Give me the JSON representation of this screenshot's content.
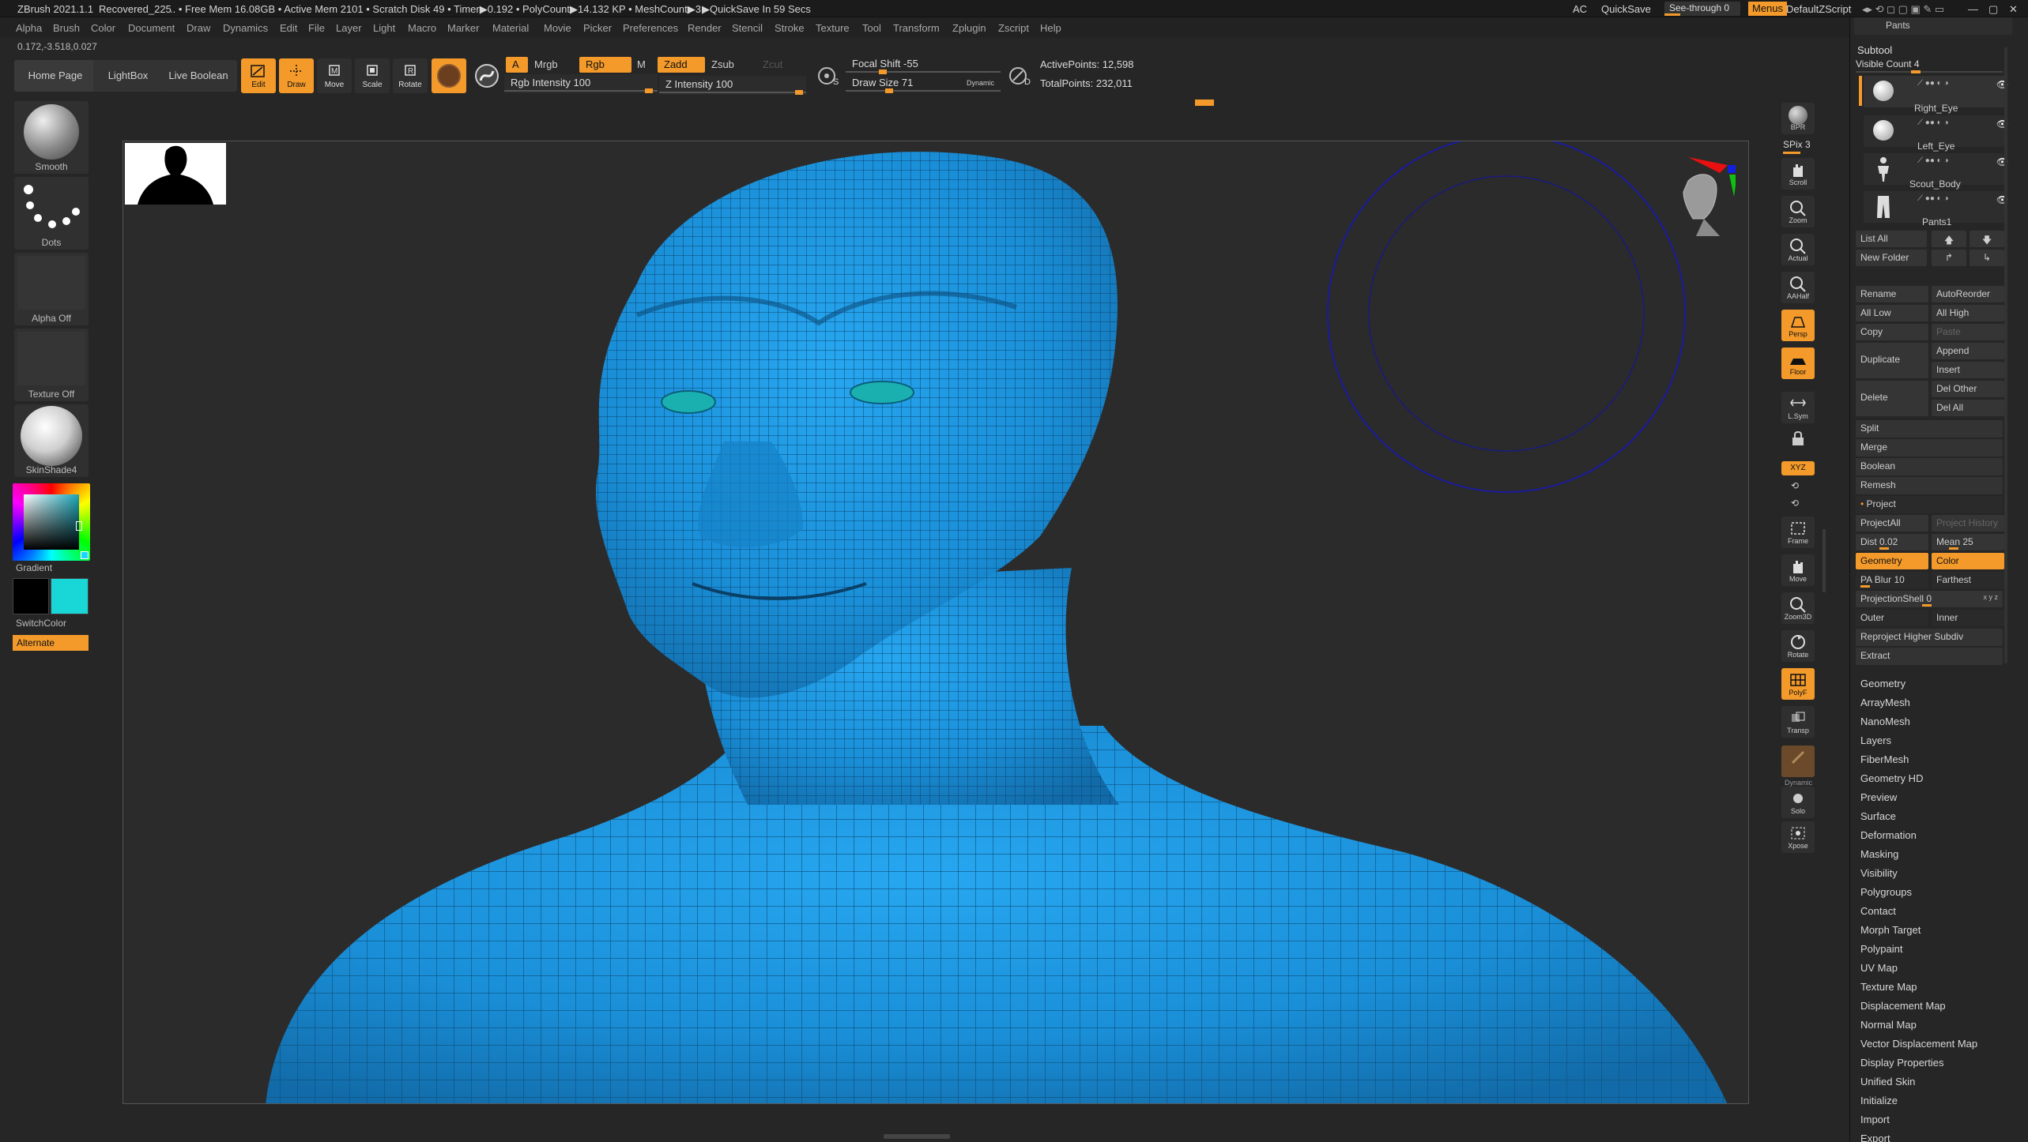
{
  "title_bar": {
    "app": "ZBrush 2021.1.1",
    "file": "Recovered_225",
    "stats": ".. • Free Mem 16.08GB • Active Mem 2101 • Scratch Disk 49 • Timer▶0.192 • PolyCount▶14.132 KP • MeshCount▶3",
    "quicksave_timer": "▶QuickSave In 59 Secs",
    "ac": "AC",
    "quicksave": "QuickSave",
    "see_through": "See-through   0",
    "menus": "Menus",
    "default_zscript": "DefaultZScript"
  },
  "menu": [
    "Alpha",
    "Brush",
    "Color",
    "Document",
    "Draw",
    "Dynamics",
    "Edit",
    "File",
    "Layer",
    "Light",
    "Macro",
    "Marker",
    "Material",
    "Movie",
    "Picker",
    "Preferences",
    "Render",
    "Stencil",
    "Stroke",
    "Texture",
    "Tool",
    "Transform",
    "Zplugin",
    "Zscript",
    "Help"
  ],
  "coords": "0.172,-3.518,0.027",
  "toolbar": {
    "home_page": "Home Page",
    "lightbox": "LightBox",
    "live_boolean": "Live Boolean",
    "edit": "Edit",
    "draw": "Draw",
    "move": "Move",
    "scale": "Scale",
    "rotate": "Rotate",
    "a": "A",
    "mrgb": "Mrgb",
    "rgb": "Rgb",
    "m": "M",
    "zadd": "Zadd",
    "zsub": "Zsub",
    "zcut": "Zcut",
    "rgb_intensity": "Rgb Intensity 100",
    "z_intensity": "Z Intensity 100",
    "focal_shift": "Focal Shift -55",
    "draw_size": "Draw Size 71",
    "dynamic": "Dynamic",
    "active_points": "ActivePoints: 12,598",
    "total_points": "TotalPoints: 232,011",
    "s_label": "S",
    "d_label": "D"
  },
  "left_shelf": {
    "smooth": "Smooth",
    "dots": "Dots",
    "alpha_off": "Alpha Off",
    "texture_off": "Texture Off",
    "material": "SkinShade4",
    "gradient": "Gradient",
    "switch_color": "SwitchColor",
    "alternate": "Alternate",
    "main_color": "#000000",
    "secondary_color": "#19d7d7"
  },
  "right_shelf": {
    "bpr": "BPR",
    "spix": "SPix 3",
    "scroll": "Scroll",
    "zoom": "Zoom",
    "actual": "Actual",
    "aahalf": "AAHalf",
    "persp": "Persp",
    "floor": "Floor",
    "lsym": "L.Sym",
    "xyz": "XYZ",
    "frame": "Frame",
    "move": "Move",
    "zoom3d": "Zoom3D",
    "rotate": "Rotate",
    "polyf": "PolyF",
    "transp": "Transp",
    "dynamic": "Dynamic",
    "solo": "Solo",
    "xpose": "Xpose"
  },
  "right_panel": {
    "pants_header": "Pants",
    "subtool_title": "Subtool",
    "visible_count": "Visible Count 4",
    "subtools": [
      "Right_Eye",
      "Left_Eye",
      "Scout_Body",
      "Pants1"
    ],
    "list_all": "List All",
    "new_folder": "New Folder",
    "rename": "Rename",
    "autoreorder": "AutoReorder",
    "all_low": "All Low",
    "all_high": "All High",
    "copy": "Copy",
    "paste": "Paste",
    "append": "Append",
    "duplicate": "Duplicate",
    "insert": "Insert",
    "del_other": "Del Other",
    "delete": "Delete",
    "del_all": "Del All",
    "split": "Split",
    "merge": "Merge",
    "boolean": "Boolean",
    "remesh": "Remesh",
    "project": "Project",
    "projectall": "ProjectAll",
    "project_history": "Project History",
    "dist": "Dist 0.02",
    "mean": "Mean 25",
    "geometry_btn": "Geometry",
    "color_btn": "Color",
    "pa_blur": "PA Blur 10",
    "farthest": "Farthest",
    "projection_shell": "ProjectionShell 0",
    "xyz_small": "x y z",
    "outer": "Outer",
    "inner": "Inner",
    "reproject": "Reproject Higher Subdiv",
    "extract": "Extract",
    "palettes": [
      "Geometry",
      "ArrayMesh",
      "NanoMesh",
      "Layers",
      "FiberMesh",
      "Geometry HD",
      "Preview",
      "Surface",
      "Deformation",
      "Masking",
      "Visibility",
      "Polygroups",
      "Contact",
      "Morph Target",
      "Polypaint",
      "UV Map",
      "Texture Map",
      "Displacement Map",
      "Normal Map",
      "Vector Displacement Map",
      "Display Properties",
      "Unified Skin",
      "Initialize",
      "Import",
      "Export"
    ]
  },
  "colors": {
    "accent": "#f39a2b",
    "mesh_blue": "#1a8fd8",
    "eye_teal": "#1ab0b0"
  }
}
